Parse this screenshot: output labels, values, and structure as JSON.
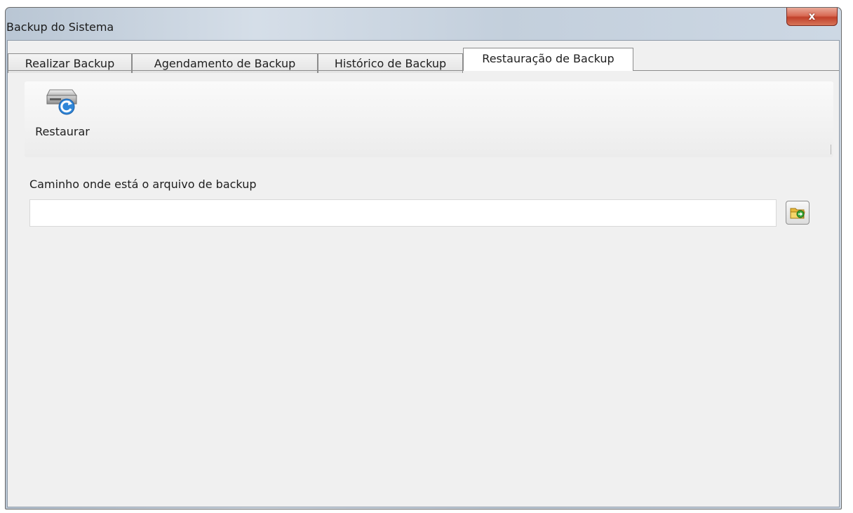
{
  "window": {
    "title": "Backup do Sistema",
    "close_label": "x"
  },
  "tabs": [
    {
      "label": "Realizar Backup",
      "active": false
    },
    {
      "label": "Agendamento de Backup",
      "active": false
    },
    {
      "label": "Histórico de Backup",
      "active": false
    },
    {
      "label": "Restauração de Backup",
      "active": true
    }
  ],
  "toolbar": {
    "restore_label": "Restaurar",
    "restore_icon": "drive-restore-icon"
  },
  "form": {
    "path_label": "Caminho onde está o arquivo de backup",
    "path_value": "",
    "browse_icon": "folder-open-icon"
  },
  "colors": {
    "client_bg": "#f0f0f0",
    "close_button": "#c94a33",
    "restore_arrow": "#2f86d8"
  }
}
